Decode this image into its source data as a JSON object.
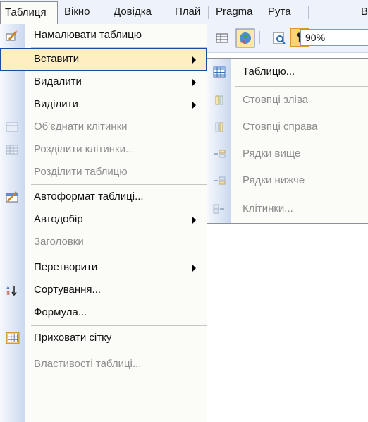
{
  "menubar": {
    "items": [
      {
        "label": "Таблиця"
      },
      {
        "label": "Вікно"
      },
      {
        "label": "Довідка"
      },
      {
        "label": "Плай"
      },
      {
        "label": "Pragma"
      },
      {
        "label": "Рута"
      },
      {
        "label": "В"
      }
    ]
  },
  "menu": {
    "items": [
      {
        "label": "Намалювати таблицю"
      },
      {
        "label": "Вставити"
      },
      {
        "label": "Видалити"
      },
      {
        "label": "Виділити"
      },
      {
        "label": "Об'єднати клітинки"
      },
      {
        "label": "Розділити клітинки..."
      },
      {
        "label": "Розділити таблицю"
      },
      {
        "label": "Автоформат таблиці..."
      },
      {
        "label": "Автодобір"
      },
      {
        "label": "Заголовки"
      },
      {
        "label": "Перетворити"
      },
      {
        "label": "Сортування..."
      },
      {
        "label": "Формула..."
      },
      {
        "label": "Приховати сітку"
      },
      {
        "label": "Властивості таблиці..."
      }
    ]
  },
  "toolbar": {
    "zoom": "90%"
  },
  "submenu": {
    "items": [
      {
        "label": "Таблицю..."
      },
      {
        "label": "Стовпці зліва"
      },
      {
        "label": "Стовпці справа"
      },
      {
        "label": "Рядки вище"
      },
      {
        "label": "Рядки нижче"
      },
      {
        "label": "Клітинки..."
      }
    ]
  },
  "colors": {
    "highlight": "#ffeec2",
    "highlight_border": "#1c4ba0",
    "disabled_text": "#8d8d8d",
    "menu_bg": "#fbfbf8",
    "gutter": "#c9d8ef"
  }
}
